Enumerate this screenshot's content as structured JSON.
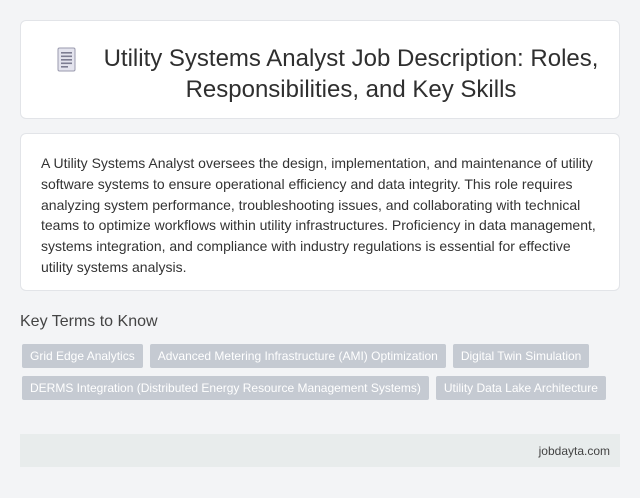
{
  "header": {
    "icon": "document-icon",
    "title": "Utility Systems Analyst Job Description: Roles, Responsibilities, and Key Skills"
  },
  "description": {
    "text": "A Utility Systems Analyst oversees the design, implementation, and maintenance of utility software systems to ensure operational efficiency and data integrity. This role requires analyzing system performance, troubleshooting issues, and collaborating with technical teams to optimize workflows within utility infrastructures. Proficiency in data management, systems integration, and compliance with industry regulations is essential for effective utility systems analysis."
  },
  "key_terms": {
    "heading": "Key Terms to Know",
    "tags": [
      "Grid Edge Analytics",
      "Advanced Metering Infrastructure (AMI) Optimization",
      "Digital Twin Simulation",
      "DERMS Integration (Distributed Energy Resource Management Systems)",
      "Utility Data Lake Architecture"
    ]
  },
  "footer": {
    "site": "jobdayta.com"
  },
  "colors": {
    "background": "#f3f4f6",
    "card": "#ffffff",
    "tag": "#c5cad2",
    "footer": "#e8ecec"
  }
}
